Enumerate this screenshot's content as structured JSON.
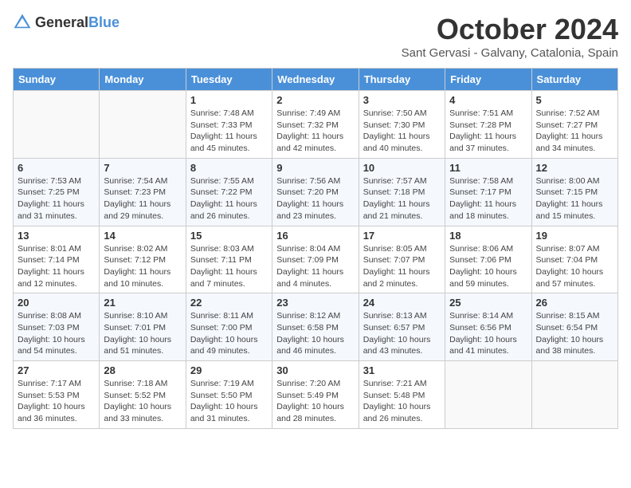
{
  "header": {
    "logo_general": "General",
    "logo_blue": "Blue",
    "month_year": "October 2024",
    "location": "Sant Gervasi - Galvany, Catalonia, Spain"
  },
  "days_of_week": [
    "Sunday",
    "Monday",
    "Tuesday",
    "Wednesday",
    "Thursday",
    "Friday",
    "Saturday"
  ],
  "weeks": [
    [
      {
        "day": "",
        "info": ""
      },
      {
        "day": "",
        "info": ""
      },
      {
        "day": "1",
        "info": "Sunrise: 7:48 AM\nSunset: 7:33 PM\nDaylight: 11 hours and 45 minutes."
      },
      {
        "day": "2",
        "info": "Sunrise: 7:49 AM\nSunset: 7:32 PM\nDaylight: 11 hours and 42 minutes."
      },
      {
        "day": "3",
        "info": "Sunrise: 7:50 AM\nSunset: 7:30 PM\nDaylight: 11 hours and 40 minutes."
      },
      {
        "day": "4",
        "info": "Sunrise: 7:51 AM\nSunset: 7:28 PM\nDaylight: 11 hours and 37 minutes."
      },
      {
        "day": "5",
        "info": "Sunrise: 7:52 AM\nSunset: 7:27 PM\nDaylight: 11 hours and 34 minutes."
      }
    ],
    [
      {
        "day": "6",
        "info": "Sunrise: 7:53 AM\nSunset: 7:25 PM\nDaylight: 11 hours and 31 minutes."
      },
      {
        "day": "7",
        "info": "Sunrise: 7:54 AM\nSunset: 7:23 PM\nDaylight: 11 hours and 29 minutes."
      },
      {
        "day": "8",
        "info": "Sunrise: 7:55 AM\nSunset: 7:22 PM\nDaylight: 11 hours and 26 minutes."
      },
      {
        "day": "9",
        "info": "Sunrise: 7:56 AM\nSunset: 7:20 PM\nDaylight: 11 hours and 23 minutes."
      },
      {
        "day": "10",
        "info": "Sunrise: 7:57 AM\nSunset: 7:18 PM\nDaylight: 11 hours and 21 minutes."
      },
      {
        "day": "11",
        "info": "Sunrise: 7:58 AM\nSunset: 7:17 PM\nDaylight: 11 hours and 18 minutes."
      },
      {
        "day": "12",
        "info": "Sunrise: 8:00 AM\nSunset: 7:15 PM\nDaylight: 11 hours and 15 minutes."
      }
    ],
    [
      {
        "day": "13",
        "info": "Sunrise: 8:01 AM\nSunset: 7:14 PM\nDaylight: 11 hours and 12 minutes."
      },
      {
        "day": "14",
        "info": "Sunrise: 8:02 AM\nSunset: 7:12 PM\nDaylight: 11 hours and 10 minutes."
      },
      {
        "day": "15",
        "info": "Sunrise: 8:03 AM\nSunset: 7:11 PM\nDaylight: 11 hours and 7 minutes."
      },
      {
        "day": "16",
        "info": "Sunrise: 8:04 AM\nSunset: 7:09 PM\nDaylight: 11 hours and 4 minutes."
      },
      {
        "day": "17",
        "info": "Sunrise: 8:05 AM\nSunset: 7:07 PM\nDaylight: 11 hours and 2 minutes."
      },
      {
        "day": "18",
        "info": "Sunrise: 8:06 AM\nSunset: 7:06 PM\nDaylight: 10 hours and 59 minutes."
      },
      {
        "day": "19",
        "info": "Sunrise: 8:07 AM\nSunset: 7:04 PM\nDaylight: 10 hours and 57 minutes."
      }
    ],
    [
      {
        "day": "20",
        "info": "Sunrise: 8:08 AM\nSunset: 7:03 PM\nDaylight: 10 hours and 54 minutes."
      },
      {
        "day": "21",
        "info": "Sunrise: 8:10 AM\nSunset: 7:01 PM\nDaylight: 10 hours and 51 minutes."
      },
      {
        "day": "22",
        "info": "Sunrise: 8:11 AM\nSunset: 7:00 PM\nDaylight: 10 hours and 49 minutes."
      },
      {
        "day": "23",
        "info": "Sunrise: 8:12 AM\nSunset: 6:58 PM\nDaylight: 10 hours and 46 minutes."
      },
      {
        "day": "24",
        "info": "Sunrise: 8:13 AM\nSunset: 6:57 PM\nDaylight: 10 hours and 43 minutes."
      },
      {
        "day": "25",
        "info": "Sunrise: 8:14 AM\nSunset: 6:56 PM\nDaylight: 10 hours and 41 minutes."
      },
      {
        "day": "26",
        "info": "Sunrise: 8:15 AM\nSunset: 6:54 PM\nDaylight: 10 hours and 38 minutes."
      }
    ],
    [
      {
        "day": "27",
        "info": "Sunrise: 7:17 AM\nSunset: 5:53 PM\nDaylight: 10 hours and 36 minutes."
      },
      {
        "day": "28",
        "info": "Sunrise: 7:18 AM\nSunset: 5:52 PM\nDaylight: 10 hours and 33 minutes."
      },
      {
        "day": "29",
        "info": "Sunrise: 7:19 AM\nSunset: 5:50 PM\nDaylight: 10 hours and 31 minutes."
      },
      {
        "day": "30",
        "info": "Sunrise: 7:20 AM\nSunset: 5:49 PM\nDaylight: 10 hours and 28 minutes."
      },
      {
        "day": "31",
        "info": "Sunrise: 7:21 AM\nSunset: 5:48 PM\nDaylight: 10 hours and 26 minutes."
      },
      {
        "day": "",
        "info": ""
      },
      {
        "day": "",
        "info": ""
      }
    ]
  ]
}
